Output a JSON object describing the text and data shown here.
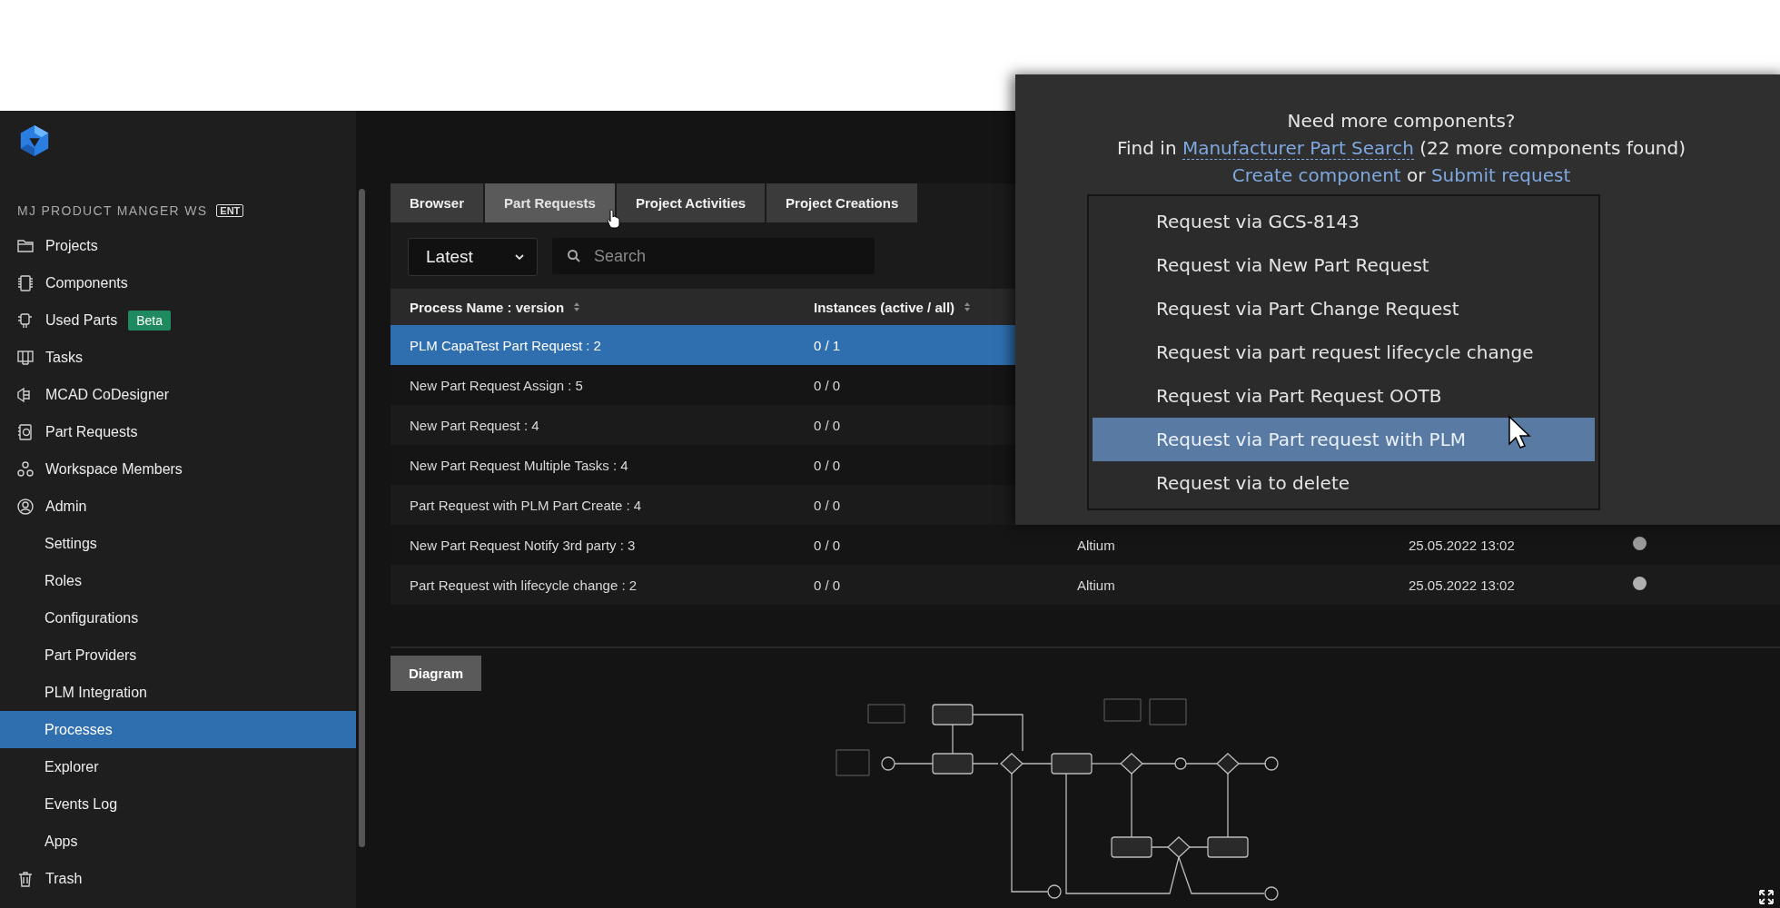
{
  "workspace": {
    "name": "MJ PRODUCT MANGER WS",
    "badge": "ENT"
  },
  "sidebar": {
    "items": [
      {
        "kind": "folder",
        "label": "Projects",
        "selected": false
      },
      {
        "kind": "chip",
        "label": "Components",
        "selected": false
      },
      {
        "kind": "parts",
        "label": "Used Parts",
        "badge": "Beta",
        "selected": false
      },
      {
        "kind": "board",
        "label": "Tasks",
        "selected": false
      },
      {
        "kind": "mcad",
        "label": "MCAD CoDesigner",
        "selected": false
      },
      {
        "kind": "request",
        "label": "Part Requests",
        "selected": false
      },
      {
        "kind": "members",
        "label": "Workspace Members",
        "selected": false
      },
      {
        "kind": "user",
        "label": "Admin",
        "selected": false,
        "children": [
          {
            "label": "Settings",
            "selected": false
          },
          {
            "label": "Roles",
            "selected": false
          },
          {
            "label": "Configurations",
            "selected": false
          },
          {
            "label": "Part Providers",
            "selected": false
          },
          {
            "label": "PLM Integration",
            "selected": false
          },
          {
            "label": "Processes",
            "selected": true
          },
          {
            "label": "Explorer",
            "selected": false
          },
          {
            "label": "Events Log",
            "selected": false
          },
          {
            "label": "Apps",
            "selected": false
          }
        ]
      },
      {
        "kind": "trash",
        "label": "Trash",
        "selected": false
      }
    ]
  },
  "tabs": [
    {
      "label": "Browser",
      "selected": false
    },
    {
      "label": "Part Requests",
      "selected": true
    },
    {
      "label": "Project Activities",
      "selected": false
    },
    {
      "label": "Project Creations",
      "selected": false
    }
  ],
  "filter": {
    "value": "Latest"
  },
  "search": {
    "placeholder": "Search"
  },
  "table": {
    "columns": [
      "Process Name : version",
      "Instances (active / all)"
    ],
    "rows": [
      {
        "name": "PLM CapaTest Part Request : 2",
        "instances": "0 / 1",
        "selected": true
      },
      {
        "name": "New Part Request Assign : 5",
        "instances": "0 / 0",
        "selected": false
      },
      {
        "name": "New Part Request : 4",
        "instances": "0 / 0",
        "selected": false
      },
      {
        "name": "New Part Request Multiple Tasks : 4",
        "instances": "0 / 0",
        "selected": false
      },
      {
        "name": "Part Request with PLM Part Create : 4",
        "instances": "0 / 0",
        "selected": false
      },
      {
        "name": "New Part Request Notify 3rd party : 3",
        "instances": "0 / 0",
        "selected": false,
        "column_3": "Altium",
        "column_4": "25.05.2022 13:02",
        "color": "#9a9a9a"
      },
      {
        "name": "Part Request with lifecycle change : 2",
        "instances": "0 / 0",
        "selected": false,
        "column_3": "Altium",
        "column_4": "25.05.2022 13:02",
        "color": "#b0b0b0"
      }
    ]
  },
  "diagram": {
    "tab": "Diagram"
  },
  "popup": {
    "heading": "Need more components?",
    "find_prefix": "Find in",
    "find_link": "Manufacturer Part Search",
    "find_suffix": "(22 more components found)",
    "create_link": "Create component",
    "joiner": "or",
    "submit_link": "Submit request",
    "menu": [
      {
        "label": "Request via GCS-8143",
        "selected": false
      },
      {
        "label": "Request via New Part Request",
        "selected": false
      },
      {
        "label": "Request via Part Change Request",
        "selected": false
      },
      {
        "label": "Request via part request lifecycle change",
        "selected": false
      },
      {
        "label": "Request via Part Request OOTB",
        "selected": false
      },
      {
        "label": "Request via Part request with PLM",
        "selected": true
      },
      {
        "label": "Request via to delete",
        "selected": false
      }
    ]
  }
}
